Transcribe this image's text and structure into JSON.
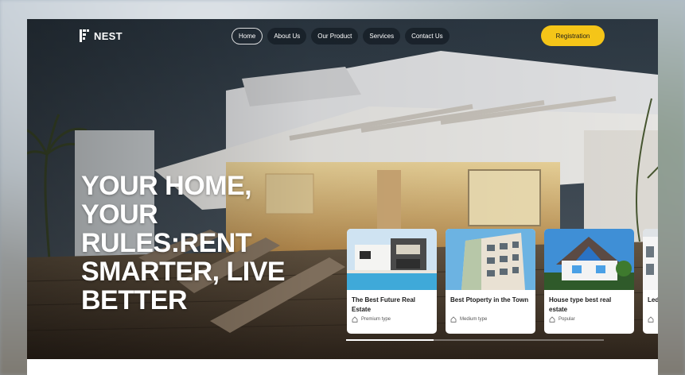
{
  "brand": {
    "name": "NEST"
  },
  "nav": {
    "items": [
      {
        "label": "Home",
        "active": true
      },
      {
        "label": "About Us",
        "active": false
      },
      {
        "label": "Our Product",
        "active": false
      },
      {
        "label": "Services",
        "active": false
      },
      {
        "label": "Contact Us",
        "active": false
      }
    ],
    "registration_label": "Registration"
  },
  "hero": {
    "headline_lines": [
      "YOUR HOME,",
      "YOUR",
      "RULES:RENT",
      "SMARTER, LIVE",
      "BETTER"
    ]
  },
  "cards": [
    {
      "title": "The Best Future Real Estate",
      "type": "Premium type",
      "icon": "home-icon"
    },
    {
      "title": "Best Ptoperty in the Town",
      "type": "Medium type",
      "icon": "home-icon"
    },
    {
      "title": "House type best real estate",
      "type": "Popular",
      "icon": "home-icon"
    },
    {
      "title": "Led Be",
      "type": "",
      "icon": "home-icon"
    }
  ],
  "carousel": {
    "progress": 0.34
  },
  "colors": {
    "accent": "#f5c518",
    "nav_bg": "#141c24",
    "card_bg": "#ffffff"
  }
}
